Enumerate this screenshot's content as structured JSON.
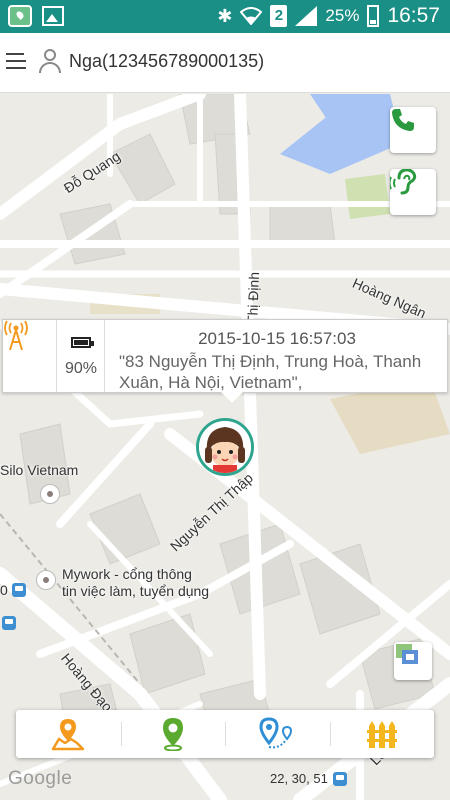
{
  "status_bar": {
    "battery": "25%",
    "time": "16:57",
    "sim_badge": "2",
    "icons": [
      "app-notification-icon",
      "gallery-icon",
      "bluetooth-icon",
      "wifi-icon",
      "sim-icon",
      "signal-icon",
      "battery-icon"
    ]
  },
  "header": {
    "device_name": "Nga(123456789000135)"
  },
  "map": {
    "labels": {
      "do_quang": "Đỗ Quang",
      "hoang_ngan": "Hoàng Ngân",
      "nguyen_thi_dinh": "Thị Định",
      "silo": "Silo Vietnam",
      "nguyen_thi_thap": "Nguyễn Thị Thập",
      "mywork_line1": "Mywork - cổng thông",
      "mywork_line2": "tin việc làm, tuyển dụng",
      "hoang_dao_thuy": "Hoàng Đạo Th",
      "bus_stop": "0",
      "le_street": "Le"
    },
    "bus_routes": "22, 30, 51",
    "attribution": "Google"
  },
  "info_popup": {
    "battery": "90%",
    "timestamp": "2015-10-15 16:57:03",
    "address": "\"83 Nguyễn Thị Định, Trung Hoà, Thanh Xuân, Hà Nội, Vietnam\","
  },
  "side_buttons": [
    "phone-call-icon",
    "listen-ear-icon"
  ],
  "toolbar": {
    "items": [
      "route-history-icon",
      "locate-pin-icon",
      "track-route-icon",
      "geofence-icon"
    ]
  },
  "colors": {
    "status_bar": "#1a8f86",
    "orange": "#f39a1e",
    "green": "#5aaa2f",
    "blue": "#2f8fd6",
    "avatar_border": "#2fa58f"
  }
}
